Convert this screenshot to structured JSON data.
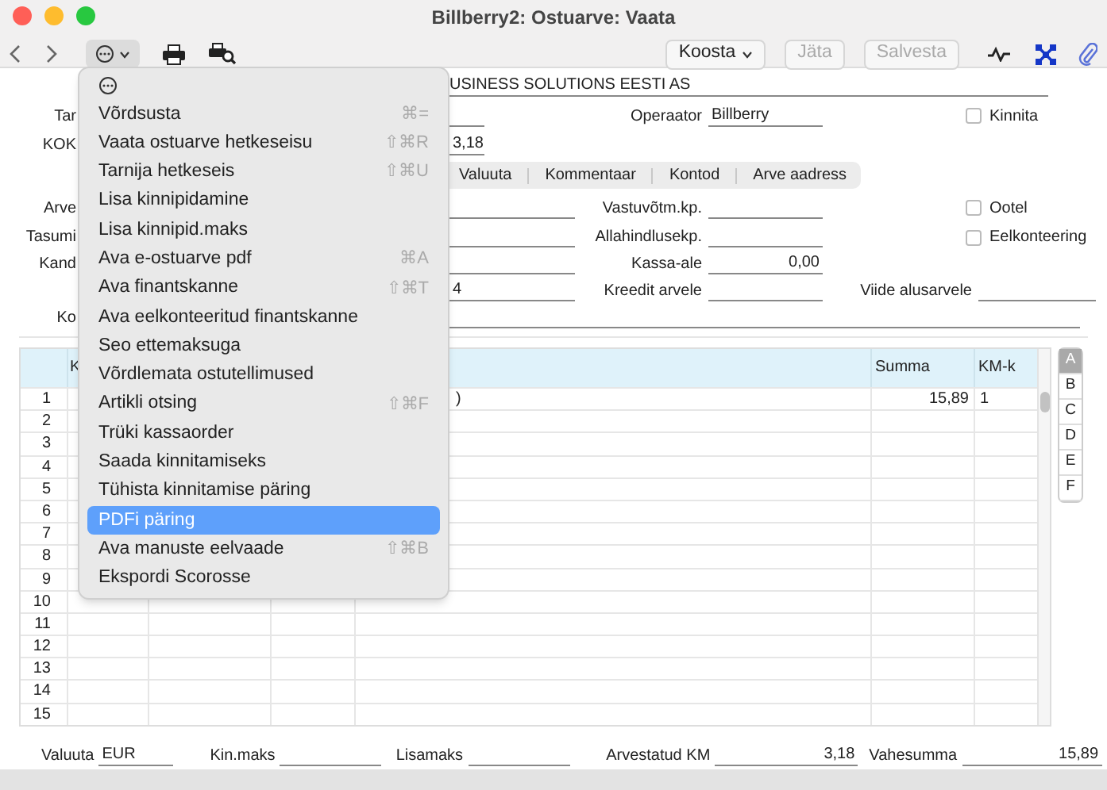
{
  "window": {
    "title": "Billberry2: Ostuarve: Vaata"
  },
  "toolbar": {
    "buttons": [
      {
        "label": "Koosta",
        "kind": "dropdown",
        "disabled": false
      },
      {
        "label": "Jäta",
        "kind": "plain",
        "disabled": true
      },
      {
        "label": "Salvesta",
        "kind": "plain",
        "disabled": true
      }
    ]
  },
  "form": {
    "company": "USINESS SOLUTIONS EESTI AS",
    "rows": [
      {
        "label": "Tar",
        "kind": "short",
        "cells": [
          {
            "label": "Operaator",
            "value": "Billberry"
          }
        ],
        "checkbox": {
          "label": "Kinnita",
          "checked": false
        }
      },
      {
        "label": "KOK",
        "kind": "short",
        "value": "3,18"
      },
      {
        "kind": "tabs",
        "tabs": [
          {
            "label": "Valuuta",
            "selected": false
          },
          {
            "label": "Kommentaar",
            "selected": false
          },
          {
            "label": "Kontod",
            "selected": false
          },
          {
            "label": "Arve aadress",
            "selected": false
          }
        ]
      },
      {
        "label": "Arve",
        "kind": "field",
        "cells": [
          {
            "label": "Vastuvõtm.kp."
          }
        ],
        "checkbox": {
          "label": "Ootel",
          "checked": false
        }
      },
      {
        "label": "Tasumi",
        "kind": "field",
        "cells": [
          {
            "label": "Allahindlusekp."
          }
        ],
        "checkbox": {
          "label": "Eelkonteering",
          "checked": false
        }
      },
      {
        "label": "Kand",
        "kind": "field",
        "cells": [
          {
            "label": "Kassa-ale",
            "value": "0,00"
          }
        ]
      },
      {
        "kind": "field",
        "value": "4",
        "cells": [
          {
            "label": "Kreedit arvele"
          },
          {
            "label": "Viide alusarvele"
          }
        ]
      },
      {
        "label": "Ko",
        "kind": "wide"
      }
    ]
  },
  "table": {
    "columns": [
      {
        "label": "K"
      },
      {},
      {},
      {},
      {
        "label": "Summa"
      },
      {
        "label": "KM-k"
      }
    ],
    "rows": [
      {
        "number": "1",
        "column_4": ")",
        "summa": "15,89",
        "km_k": "1"
      },
      {
        "number": "2"
      },
      {
        "number": "3"
      },
      {
        "number": "4"
      },
      {
        "number": "5"
      },
      {
        "number": "6"
      },
      {
        "number": "7"
      },
      {
        "number": "8"
      },
      {
        "number": "9"
      },
      {
        "number": "10"
      },
      {
        "number": "11"
      },
      {
        "number": "12"
      },
      {
        "number": "13"
      },
      {
        "number": "14"
      },
      {
        "number": "15"
      }
    ]
  },
  "side_tabs": [
    {
      "label": "A",
      "selected": true
    },
    {
      "label": "B",
      "selected": false
    },
    {
      "label": "C",
      "selected": false
    },
    {
      "label": "D",
      "selected": false
    },
    {
      "label": "E",
      "selected": false
    },
    {
      "label": "F",
      "selected": false
    }
  ],
  "footer": [
    {
      "label": "Valuuta",
      "value": "EUR"
    },
    {
      "label": "Kin.maks"
    },
    {
      "label": "Lisamaks"
    },
    {
      "label": "Arvestatud KM",
      "value": "3,18"
    },
    {
      "label": "Vahesumma",
      "value": "15,89"
    }
  ],
  "menu": {
    "items": [
      {
        "label": "Võrdsusta",
        "shortcut": "⌘=",
        "selected": false
      },
      {
        "label": "Vaata ostuarve hetkeseisu",
        "shortcut": "⇧⌘R",
        "selected": false
      },
      {
        "label": "Tarnija hetkeseis",
        "shortcut": "⇧⌘U",
        "selected": false
      },
      {
        "label": "Lisa kinnipidamine",
        "selected": false
      },
      {
        "label": "Lisa kinnipid.maks",
        "selected": false
      },
      {
        "label": "Ava e-ostuarve pdf",
        "shortcut": "⌘A",
        "selected": false
      },
      {
        "label": "Ava finantskanne",
        "shortcut": "⇧⌘T",
        "selected": false
      },
      {
        "label": "Ava eelkonteeritud finantskanne",
        "selected": false
      },
      {
        "label": "Seo ettemaksuga",
        "selected": false
      },
      {
        "label": "Võrdlemata ostutellimused",
        "selected": false
      },
      {
        "label": "Artikli otsing",
        "shortcut": "⇧⌘F",
        "selected": false
      },
      {
        "label": "Trüki kassaorder",
        "selected": false
      },
      {
        "label": "Saada kinnitamiseks",
        "selected": false
      },
      {
        "label": "Tühista kinnitamise päring",
        "selected": false
      },
      {
        "label": "PDFi päring",
        "selected": true
      },
      {
        "label": "Ava manuste eelvaade",
        "shortcut": "⇧⌘B",
        "selected": false
      },
      {
        "label": "Ekspordi Scorosse",
        "selected": false
      }
    ]
  }
}
